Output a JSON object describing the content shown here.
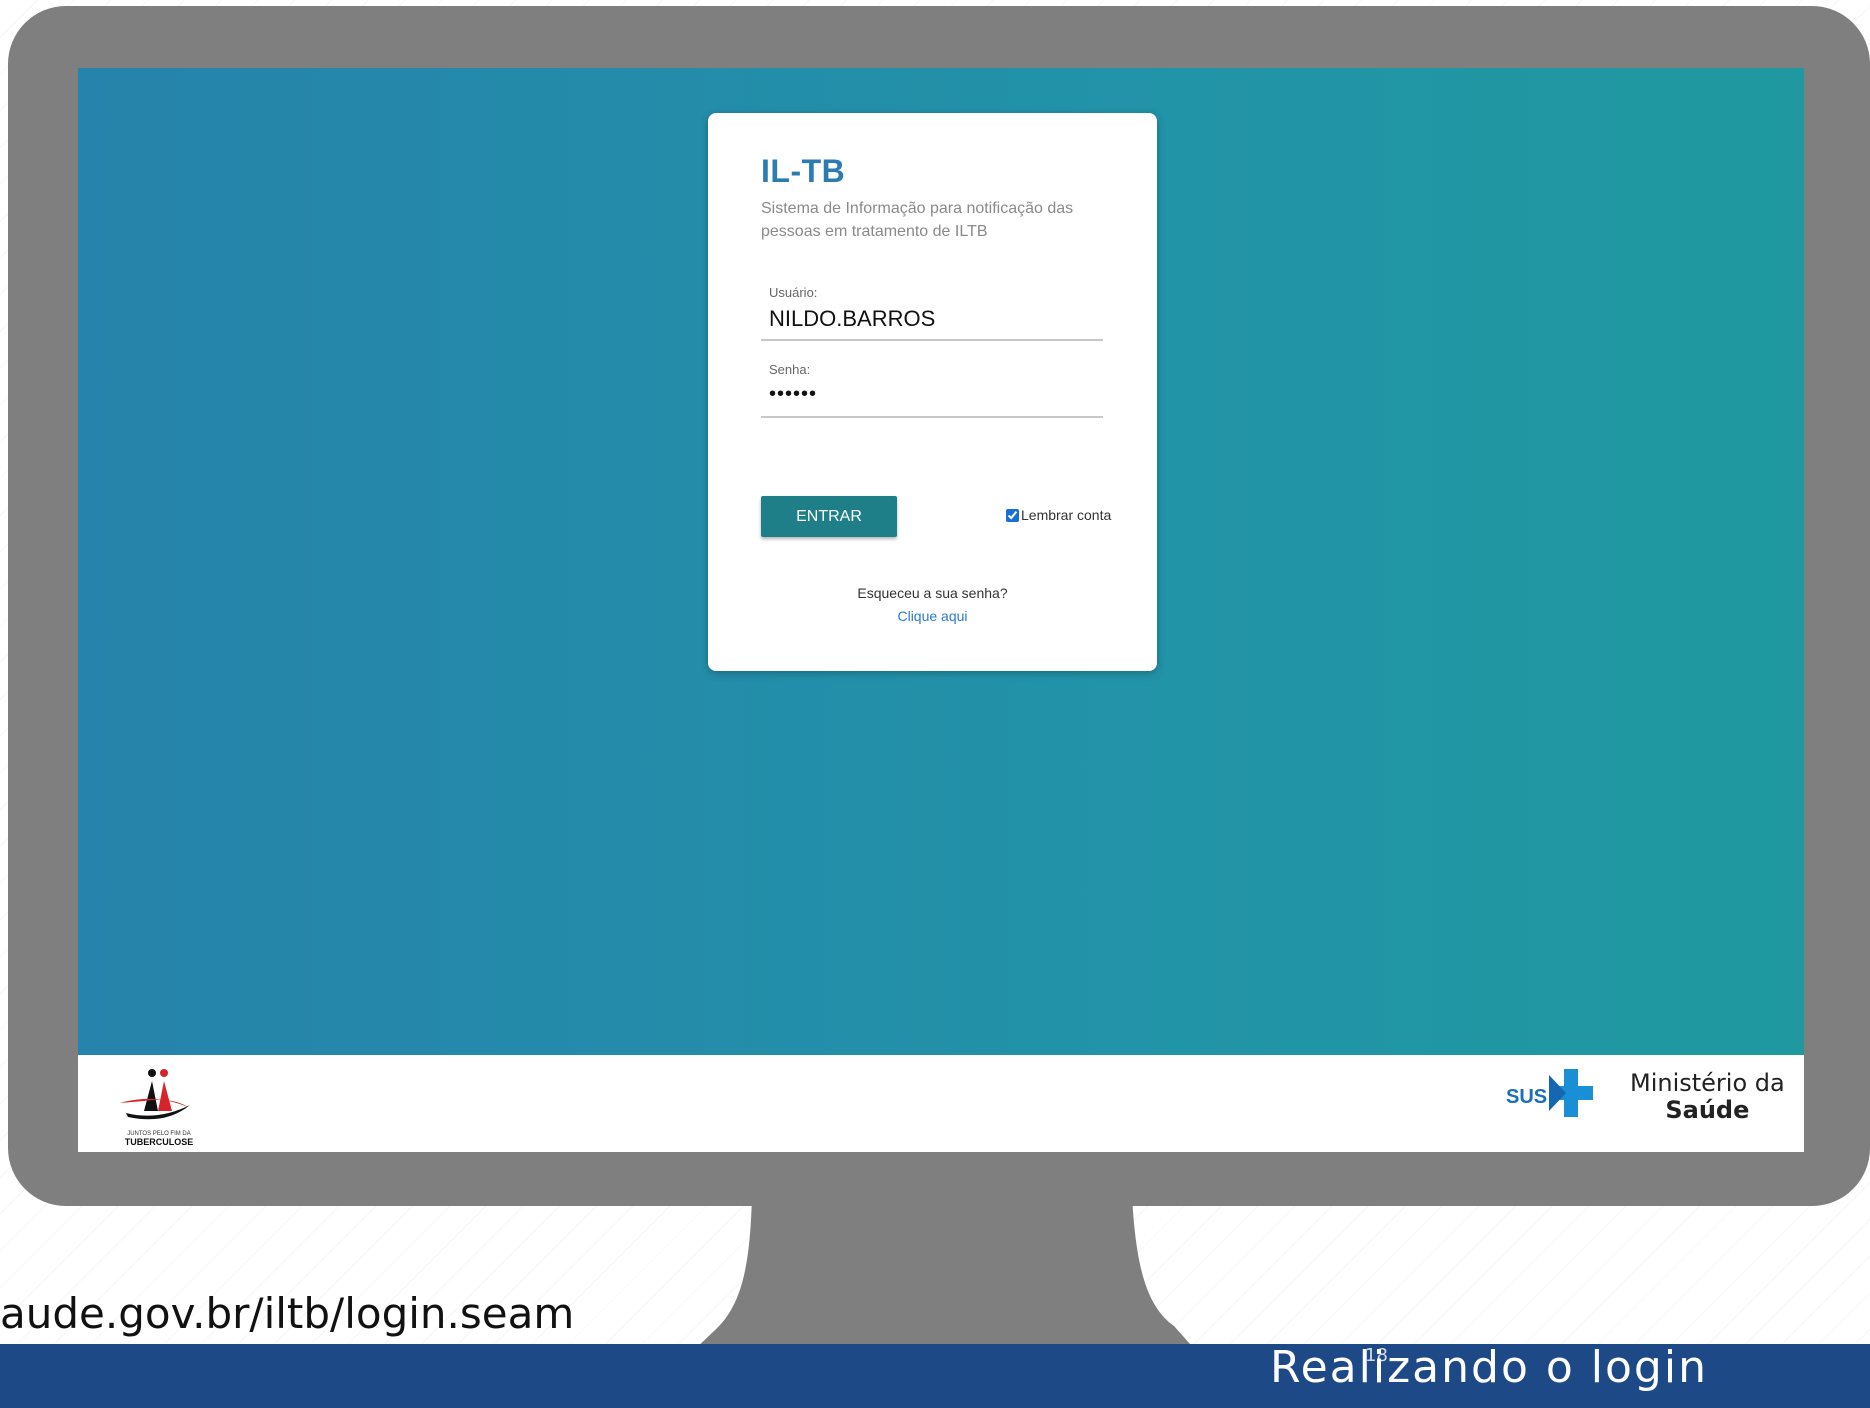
{
  "slide": {
    "url_fragment": "aude.gov.br/iltb/login.seam",
    "title": "Realizando o login",
    "page_number": "18"
  },
  "login": {
    "app_title": "IL-TB",
    "app_subtitle": "Sistema de Informação para notificação das pessoas em tratamento de ILTB",
    "username_label": "Usuário:",
    "username_value": "NILDO.BARROS",
    "password_label": "Senha:",
    "password_value": "••••••",
    "submit_label": "ENTRAR",
    "remember_label": "Lembrar conta",
    "remember_checked": true,
    "forgot_text": "Esqueceu a sua senha?",
    "forgot_link": "Clique aqui"
  },
  "footer": {
    "sus_text": "SUS",
    "ministerio_line1": "Ministério da",
    "ministerio_line2": "Saúde",
    "tb_logo_text": "JUNTOS PELO FIM DA TUBERCULOSE"
  },
  "colors": {
    "screen_gradient_start": "#2683ab",
    "screen_gradient_end": "#1f999f",
    "brand_blue": "#2a7cb2",
    "button_teal": "#1f7f88",
    "link_blue": "#2a7cd0",
    "bottom_bar": "#1e4987",
    "monitor_gray": "#7f7f7f"
  }
}
